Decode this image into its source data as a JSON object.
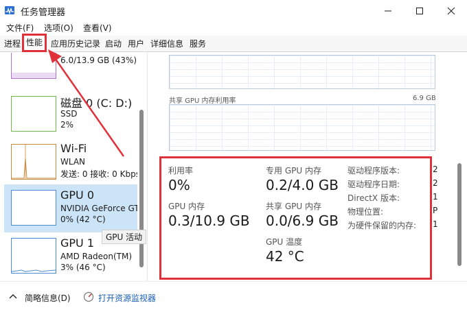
{
  "window": {
    "title": "任务管理器"
  },
  "menu": [
    "文件(F)",
    "选项(O)",
    "查看(V)"
  ],
  "tabs": [
    "进程",
    "性能",
    "应用历史记录",
    "启动",
    "用户",
    "详细信息",
    "服务"
  ],
  "left_items": [
    {
      "title": "..",
      "line1": "6.0/13.9 GB (43%)",
      "line2": ""
    },
    {
      "title": "磁盘 0 (C: D:)",
      "line1": "SSD",
      "line2": "2%"
    },
    {
      "title": "Wi-Fi",
      "line1": "WLAN",
      "line2": "发送: 0 接收: 0 Kbps"
    },
    {
      "title": "GPU 0",
      "line1": "NVIDIA GeForce GT",
      "line2": "0% (42 °C)"
    },
    {
      "title": "GPU 1",
      "line1": "AMD Radeon(TM)",
      "line2": "3% (46 °C)"
    }
  ],
  "tooltip": "GPU 活动",
  "graph_labels": {
    "shared_left": "共享 GPU 内存利用率",
    "shared_right": "6.9 GB"
  },
  "stats": [
    {
      "label": "利用率",
      "value": "0%"
    },
    {
      "label": "专用 GPU 内存",
      "value": "0.2/4.0 GB"
    },
    {
      "label": "GPU 内存",
      "value": "0.3/10.9 GB"
    },
    {
      "label": "共享 GPU 内存",
      "value": "0.0/6.9 GB"
    },
    {
      "label": "GPU 温度",
      "value": "42 °C"
    }
  ],
  "kv": [
    {
      "label": "驱动程序版本:",
      "value": "2"
    },
    {
      "label": "驱动程序日期:",
      "value": "2"
    },
    {
      "label": "DirectX 版本:",
      "value": "1"
    },
    {
      "label": "物理位置:",
      "value": "P"
    },
    {
      "label": "为硬件保留的内存:",
      "value": "1"
    }
  ],
  "footer": {
    "summary": "简略信息(D)",
    "monitor": "打开资源监视器"
  },
  "colors": {
    "highlight": "#e0303a",
    "selected": "#cce4f7",
    "link": "#1a5fb4"
  }
}
